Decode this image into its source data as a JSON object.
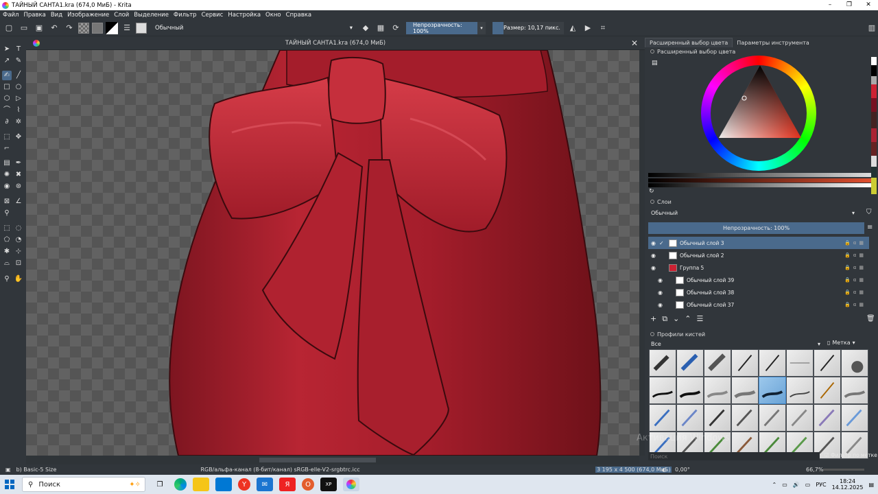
{
  "window": {
    "title": "ТАЙНЫЙ САНТА1.kra (674,0 МиБ)  - Krita",
    "controls": [
      "–",
      "❐",
      "✕"
    ]
  },
  "menu": [
    "Файл",
    "Правка",
    "Вид",
    "Изображение",
    "Слой",
    "Выделение",
    "Фильтр",
    "Сервис",
    "Настройка",
    "Окно",
    "Справка"
  ],
  "toolbar": {
    "blend_mode": "Обычный",
    "opacity_label": "Непрозрачность: 100%",
    "size_label": "Размер: 10,17 пикс."
  },
  "document": {
    "tab_title": "ТАЙНЫЙ САНТА1.kra (674,0 МиБ)"
  },
  "right_panel": {
    "tabs": [
      "Расширенный выбор цвета",
      "Параметры инструмента"
    ],
    "color_dock_title": "Расширенный выбор цвета",
    "layers_title": "Слои",
    "layers_blend": "Обычный",
    "layers_opacity": "Непрозрачность:  100%",
    "layers": [
      {
        "name": "Обычный слой 3",
        "selected": true
      },
      {
        "name": "Обычный слой 2",
        "selected": false
      },
      {
        "name": "Группа 5",
        "selected": false
      },
      {
        "name": "Обычный слой 39",
        "selected": false
      },
      {
        "name": "Обычный слой 38",
        "selected": false
      },
      {
        "name": "Обычный слой 37",
        "selected": false
      }
    ],
    "brushes_title": "Профили кистей",
    "brush_filter": "Все",
    "tag_label": "Метка",
    "search_placeholder": "Поиск",
    "filter_by_tag": "Фильтр по метке",
    "watermark": "Активация Windows"
  },
  "status": {
    "brush": "b) Basic-5 Size",
    "color_space": "RGB/альфа-канал (8-бит/канал)  sRGB-elle-V2-srgbtrc.icc",
    "image_size": "3 195 x 4 500 (674,0 МиБ)",
    "rotation": "0,00°",
    "zoom": "66,7%"
  },
  "taskbar": {
    "search": "Поиск",
    "lang": "РУС",
    "time": "18:24",
    "date": "14.12.2025"
  },
  "colors": {
    "accent": "#4a6a8c",
    "dress": "#b8232f"
  }
}
